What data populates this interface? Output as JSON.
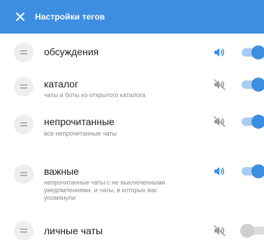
{
  "header": {
    "title": "Настройки тегов",
    "close_icon": "close-icon"
  },
  "colors": {
    "header_bg": "#3d8ee1",
    "accent": "#3d8ee1",
    "toggle_track_on": "#a7cdf3",
    "toggle_off": "#cfcfcf",
    "muted_icon": "#9a9a9a"
  },
  "tags": [
    {
      "title": "обсуждения",
      "description": "",
      "sound_icon": "speaker-on-icon",
      "sound_on": true,
      "enabled": true
    },
    {
      "title": "каталог",
      "description": "чаты и боты из открытого каталога",
      "sound_icon": "speaker-muted-icon",
      "sound_on": false,
      "enabled": true
    },
    {
      "title": "непрочитанные",
      "description": "все непрочитанные чаты",
      "sound_icon": "speaker-muted-icon",
      "sound_on": false,
      "enabled": true
    },
    {
      "title": "важные",
      "description": "непрочитанные чаты с не выключенными уведомлениями, и чаты, в которых вас упомянули",
      "sound_icon": "speaker-on-icon",
      "sound_on": true,
      "enabled": true
    },
    {
      "title": "личные чаты",
      "description": "",
      "sound_icon": "speaker-muted-icon",
      "sound_on": false,
      "enabled": false
    }
  ]
}
